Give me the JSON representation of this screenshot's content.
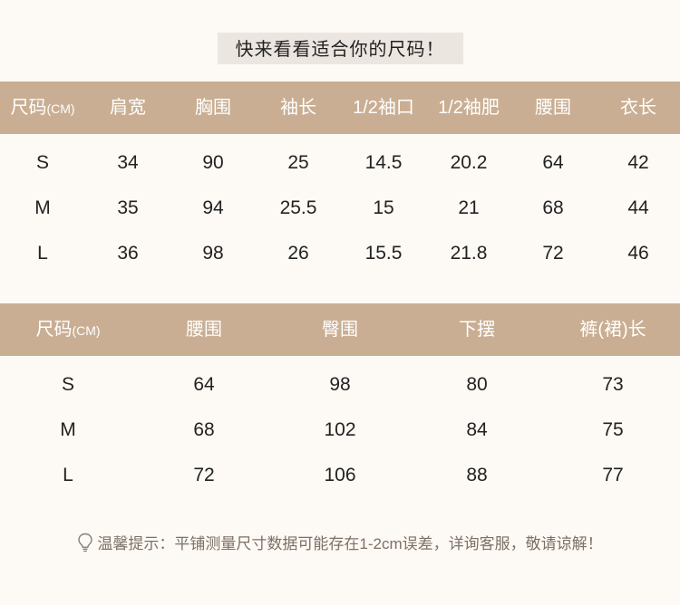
{
  "title": "快来看看适合你的尺码！",
  "table1": {
    "size_label": "尺码",
    "size_unit": "(CM)",
    "headers": [
      "肩宽",
      "胸围",
      "袖长",
      "1/2袖口",
      "1/2袖肥",
      "腰围",
      "衣长"
    ],
    "rows": [
      [
        "S",
        "34",
        "90",
        "25",
        "14.5",
        "20.2",
        "64",
        "42"
      ],
      [
        "M",
        "35",
        "94",
        "25.5",
        "15",
        "21",
        "68",
        "44"
      ],
      [
        "L",
        "36",
        "98",
        "26",
        "15.5",
        "21.8",
        "72",
        "46"
      ]
    ]
  },
  "table2": {
    "size_label": "尺码",
    "size_unit": "(CM)",
    "headers": [
      "腰围",
      "臀围",
      "下摆",
      "裤(裙)长"
    ],
    "rows": [
      [
        "S",
        "64",
        "98",
        "80",
        "73"
      ],
      [
        "M",
        "68",
        "102",
        "84",
        "75"
      ],
      [
        "L",
        "72",
        "106",
        "88",
        "77"
      ]
    ]
  },
  "tip": "温馨提示：平铺测量尺寸数据可能存在1-2cm误差，详询客服，敬请谅解！",
  "icons": {
    "tip": "lightbulb-icon"
  },
  "colors": {
    "header_band": "#c9ae93",
    "background": "#fdf9f4",
    "title_bg": "#ece6e0"
  }
}
